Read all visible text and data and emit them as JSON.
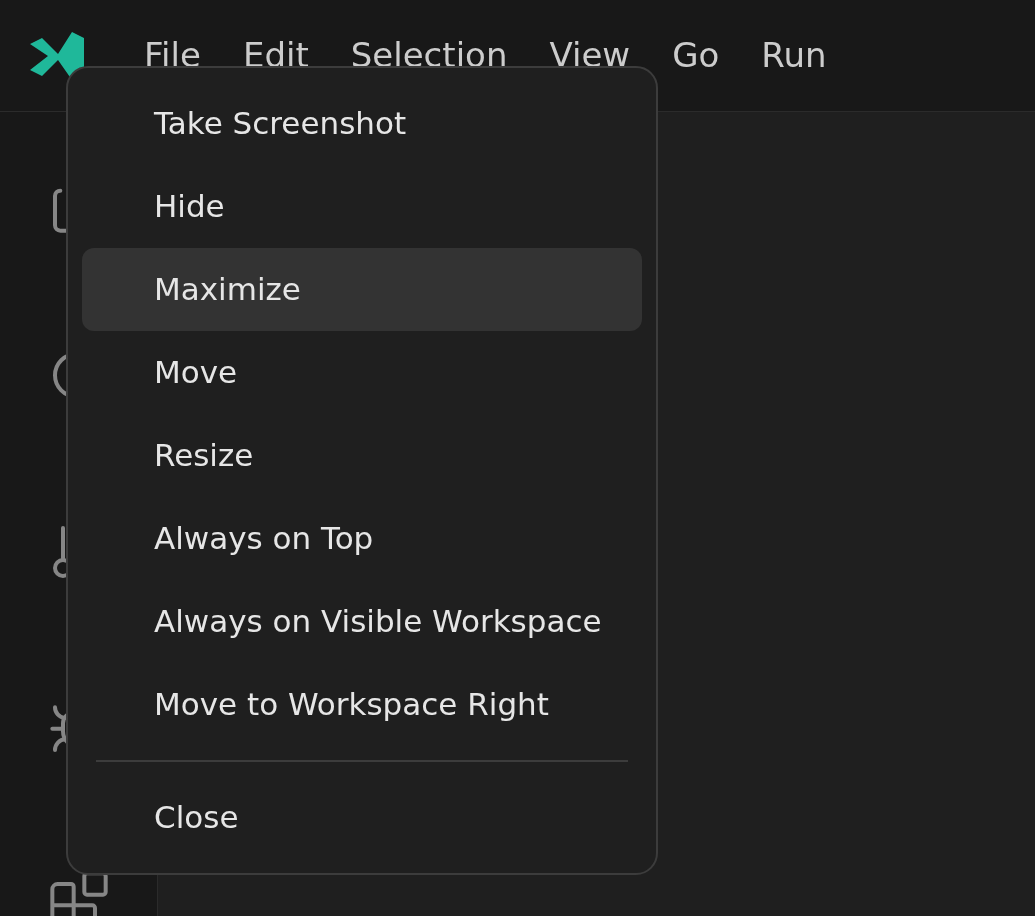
{
  "menubar": [
    {
      "label": "File"
    },
    {
      "label": "Edit"
    },
    {
      "label": "Selection"
    },
    {
      "label": "View"
    },
    {
      "label": "Go"
    },
    {
      "label": "Run"
    }
  ],
  "context_menu": [
    {
      "kind": "item",
      "label": "Take Screenshot",
      "selected": false
    },
    {
      "kind": "item",
      "label": "Hide",
      "selected": false
    },
    {
      "kind": "item",
      "label": "Maximize",
      "selected": true
    },
    {
      "kind": "item",
      "label": "Move",
      "selected": false
    },
    {
      "kind": "item",
      "label": "Resize",
      "selected": false
    },
    {
      "kind": "item",
      "label": "Always on Top",
      "selected": false
    },
    {
      "kind": "item",
      "label": "Always on Visible Workspace",
      "selected": false
    },
    {
      "kind": "item",
      "label": "Move to Workspace Right",
      "selected": false
    },
    {
      "kind": "separator"
    },
    {
      "kind": "item",
      "label": "Close",
      "selected": false
    }
  ]
}
